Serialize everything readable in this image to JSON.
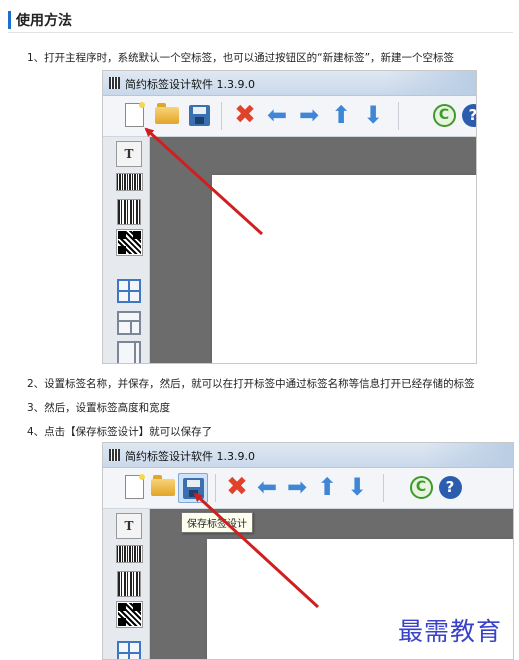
{
  "section": {
    "title": "使用方法"
  },
  "steps": {
    "step1": "1、打开主程序时，系统默认一个空标签，也可以通过按钮区的“新建标签”，新建一个空标签",
    "step2": "2、设置标签名称，并保存，然后，就可以在打开标签中通过标签名称等信息打开已经存储的标签",
    "step3": "3、然后，设置标签高度和宽度",
    "step4": "4、点击【保存标签设计】就可以保存了"
  },
  "screenshot1": {
    "app_title": "简约标签设计软件  1.3.9.0",
    "highlighted_button": "new-label"
  },
  "screenshot2": {
    "app_title": "简约标签设计软件  1.3.9.0",
    "highlighted_button": "save-label",
    "tooltip": "保存标签设计"
  },
  "toolbar_icons": [
    "new-label-icon",
    "open-folder-icon",
    "save-disk-icon",
    "delete-icon",
    "arrow-left-icon",
    "arrow-right-icon",
    "arrow-up-icon",
    "arrow-down-icon",
    "copyright-icon",
    "help-icon"
  ],
  "sidebar_icons": [
    "text-tool-icon",
    "barcode-1d-icon",
    "barcode-vertical-icon",
    "qr-code-icon",
    "table-grid-icon",
    "table-split-icon",
    "table-columns-icon"
  ],
  "watermark": "最需教育",
  "colors": {
    "accent_bar": "#1d6fc9",
    "arrow": "#d01f1f",
    "watermark": "#3942c8"
  }
}
